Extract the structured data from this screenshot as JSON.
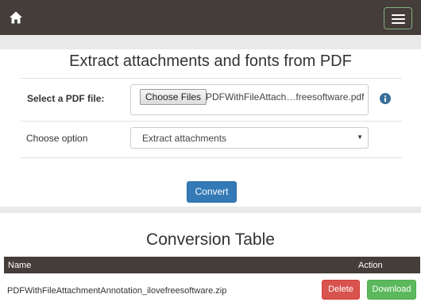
{
  "navbar": {
    "home_icon": "home-icon",
    "menu_icon": "hamburger-icon",
    "background": "#453d3a"
  },
  "form": {
    "title": "Extract attachments and fonts from PDF",
    "file_label": "Select a PDF file:",
    "choose_files_label": "Choose Files",
    "selected_file_name": "PDFWithFileAttach…freesoftware.pdf",
    "info_icon": "info-circle-icon",
    "option_label": "Choose option",
    "option_selected": "Extract attachments",
    "convert_label": "Convert",
    "convert_color": "#337ab7"
  },
  "table": {
    "title": "Conversion Table",
    "columns": [
      "Name",
      "Action"
    ],
    "rows": [
      {
        "name": "PDFWithFileAttachmentAnnotation_ilovefreesoftware.zip",
        "delete_label": "Delete",
        "download_label": "Download"
      }
    ],
    "delete_color": "#d9534f",
    "download_color": "#5cb85c"
  }
}
